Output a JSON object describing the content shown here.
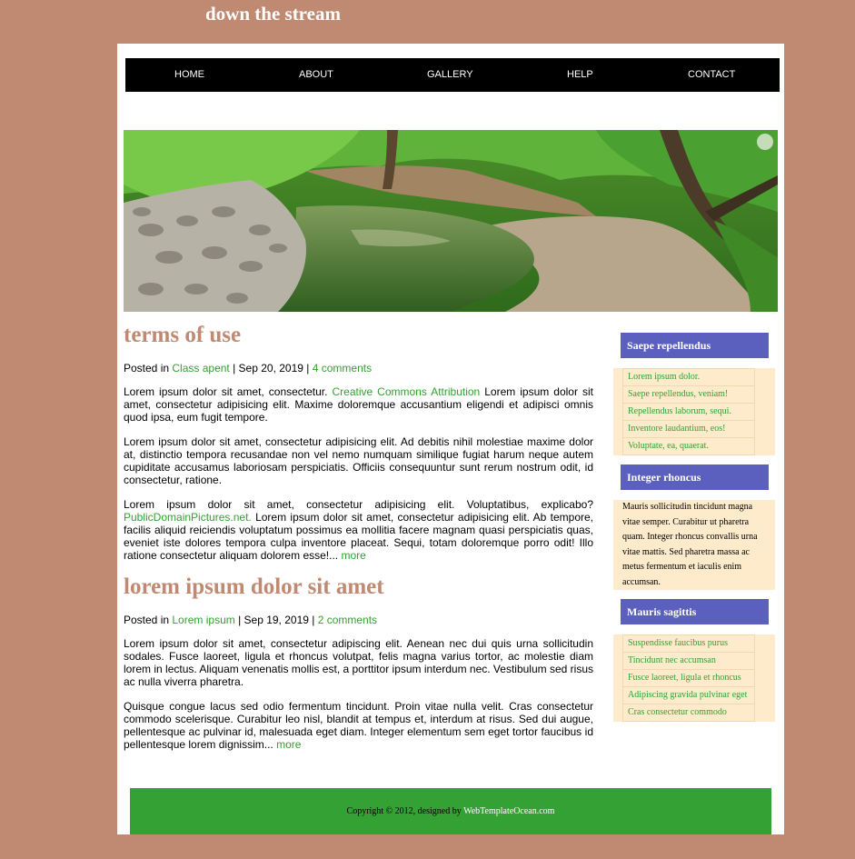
{
  "site": {
    "title": "down the stream"
  },
  "nav": {
    "items": [
      {
        "label": "HOME"
      },
      {
        "label": "ABOUT"
      },
      {
        "label": "GALLERY"
      },
      {
        "label": "HELP"
      },
      {
        "label": "CONTACT"
      }
    ]
  },
  "posts": [
    {
      "title": "terms of use",
      "meta": {
        "prefix": "Posted in ",
        "category": "Class apent",
        "date": " | Sep 20, 2019 | ",
        "comments": "4 comments"
      },
      "p1": {
        "before": "Lorem ipsum dolor sit amet, consectetur. ",
        "link": "Creative Commons Attribution",
        "after": " Lorem ipsum dolor sit amet, consectetur adipisicing elit. Maxime doloremque accusantium eligendi et adipisci omnis quod ipsa, eum fugit tempore."
      },
      "p2": "Lorem ipsum dolor sit amet, consectetur adipisicing elit. Ad debitis nihil molestiae maxime dolor at, distinctio tempora recusandae non vel nemo numquam similique fugiat harum neque autem cupiditate accusamus laboriosam perspiciatis. Officiis consequuntur sunt rerum nostrum odit, id consectetur, ratione.",
      "p3": {
        "before": "Lorem ipsum dolor sit amet, consectetur adipisicing elit. Voluptatibus, explicabo? ",
        "link": "PublicDomainPictures.net.",
        "after": " Lorem ipsum dolor sit amet, consectetur adipisicing elit. Ab tempore, facilis aliquid reiciendis voluptatum possimus ea mollitia facere magnam quasi perspiciatis quas, eveniet iste dolores tempora culpa inventore placeat. Sequi, totam doloremque porro odit! Illo ratione consectetur aliquam dolorem esse!... ",
        "more": "more"
      }
    },
    {
      "title": "lorem ipsum dolor sit amet",
      "meta": {
        "prefix": "Posted in ",
        "category": "Lorem ipsum",
        "date": " | Sep 19, 2019 | ",
        "comments": "2 comments"
      },
      "p1": "Lorem ipsum dolor sit amet, consectetur adipiscing elit. Aenean nec dui quis urna sollicitudin sodales. Fusce laoreet, ligula et rhoncus volutpat, felis magna varius tortor, ac molestie diam lorem in lectus. Aliquam venenatis mollis est, a porttitor ipsum interdum nec. Vestibulum sed risus ac nulla viverra pharetra.",
      "p2": {
        "before": "Quisque congue lacus sed odio fermentum tincidunt. Proin vitae nulla velit. Cras consectetur commodo scelerisque. Curabitur leo nisl, blandit at tempus et, interdum at risus. Sed dui augue, pellentesque ac pulvinar id, malesuada eget diam. Integer elementum sem eget tortor faucibus id pellentesque lorem dignissim... ",
        "more": "more"
      }
    }
  ],
  "sidebar": {
    "box1": {
      "heading": "Saepe repellendus",
      "items": [
        "Lorem ipsum dolor.",
        "Saepe repellendus, veniam!",
        "Repellendus laborum, sequi.",
        "Inventore laudantium, eos!",
        "Voluptate, ea, quaerat."
      ]
    },
    "box2": {
      "heading": "Integer rhoncus",
      "text": "Mauris sollicitudin tincidunt magna vitae semper. Curabitur ut pharetra quam. Integer rhoncus convallis urna vitae mattis. Sed pharetra massa ac metus fermentum et iaculis enim accumsan."
    },
    "box3": {
      "heading": "Mauris sagittis",
      "items": [
        "Suspendisse faucibus purus",
        "Tincidunt nec accumsan",
        "Fusce laoreet, ligula et rhoncus",
        "Adipiscing gravida pulvinar eget",
        "Cras consectetur commodo"
      ]
    }
  },
  "footer": {
    "text": "Copyright © 2012, designed by ",
    "link": "WebTemplateOcean.com"
  },
  "colors": {
    "background": "#c08a72",
    "nav": "#000000",
    "accent_link": "#33a033",
    "sidebar_head": "#5b5fbd",
    "sidebar_box": "#fdebcb",
    "footer": "#33a133"
  }
}
